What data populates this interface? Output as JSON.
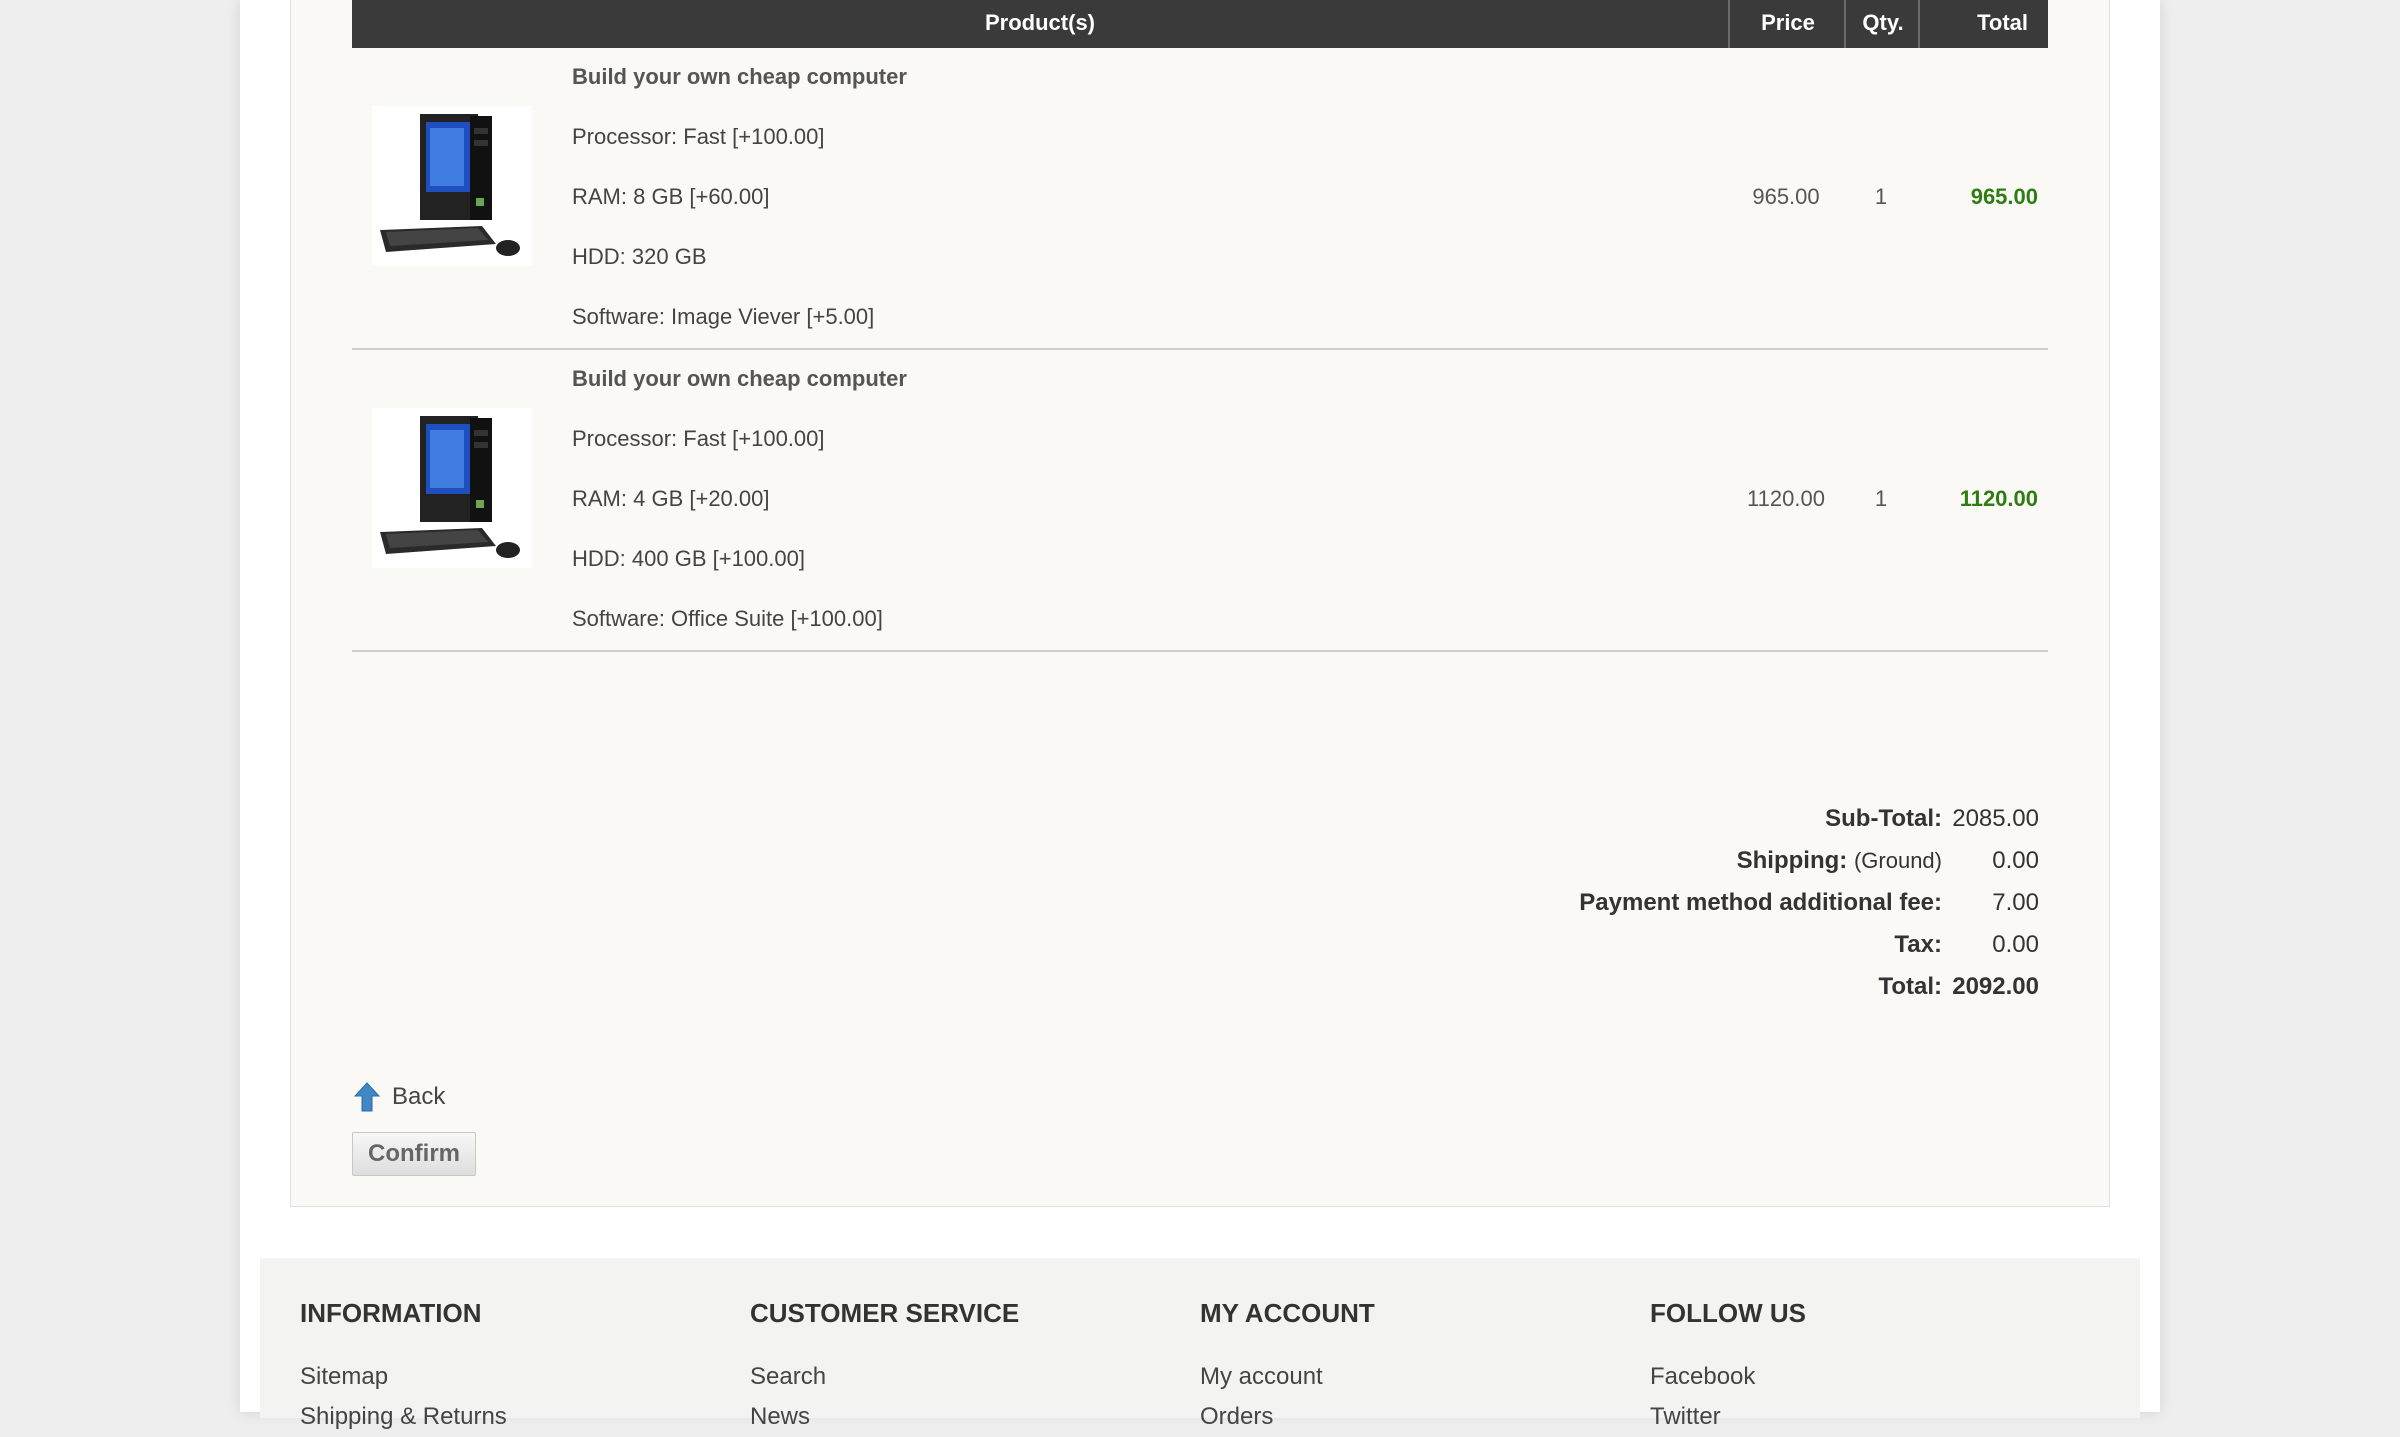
{
  "cart": {
    "headers": {
      "product": "Product(s)",
      "price": "Price",
      "qty": "Qty.",
      "total": "Total"
    },
    "items": [
      {
        "name": "Build your own cheap computer",
        "attributes": [
          "Processor: Fast [+100.00]",
          "RAM: 8 GB [+60.00]",
          "HDD: 320 GB",
          "Software: Image Viever [+5.00]"
        ],
        "price": "965.00",
        "qty": "1",
        "total": "965.00"
      },
      {
        "name": "Build your own cheap computer",
        "attributes": [
          "Processor: Fast [+100.00]",
          "RAM: 4 GB [+20.00]",
          "HDD: 400 GB [+100.00]",
          "Software: Office Suite [+100.00]"
        ],
        "price": "1120.00",
        "qty": "1",
        "total": "1120.00"
      }
    ]
  },
  "totals": {
    "subtotal_label": "Sub-Total:",
    "subtotal": "2085.00",
    "shipping_label": "Shipping:",
    "shipping_method": "(Ground)",
    "shipping": "0.00",
    "payment_fee_label": "Payment method additional fee:",
    "payment_fee": "7.00",
    "tax_label": "Tax:",
    "tax": "0.00",
    "total_label": "Total:",
    "total": "2092.00"
  },
  "actions": {
    "back_label": "Back",
    "confirm_label": "Confirm"
  },
  "footer": {
    "columns": [
      {
        "heading": "INFORMATION",
        "links": [
          "Sitemap",
          "Shipping & Returns"
        ]
      },
      {
        "heading": "CUSTOMER SERVICE",
        "links": [
          "Search",
          "News"
        ]
      },
      {
        "heading": "MY ACCOUNT",
        "links": [
          "My account",
          "Orders"
        ]
      },
      {
        "heading": "FOLLOW US",
        "links": [
          "Facebook",
          "Twitter"
        ]
      }
    ]
  },
  "colors": {
    "header_bg": "#3a3a3a",
    "total_green": "#2e7d12",
    "panel_bg": "#faf9f6"
  },
  "icons": {
    "back": "up-arrow-icon",
    "product": "computer-icon"
  }
}
